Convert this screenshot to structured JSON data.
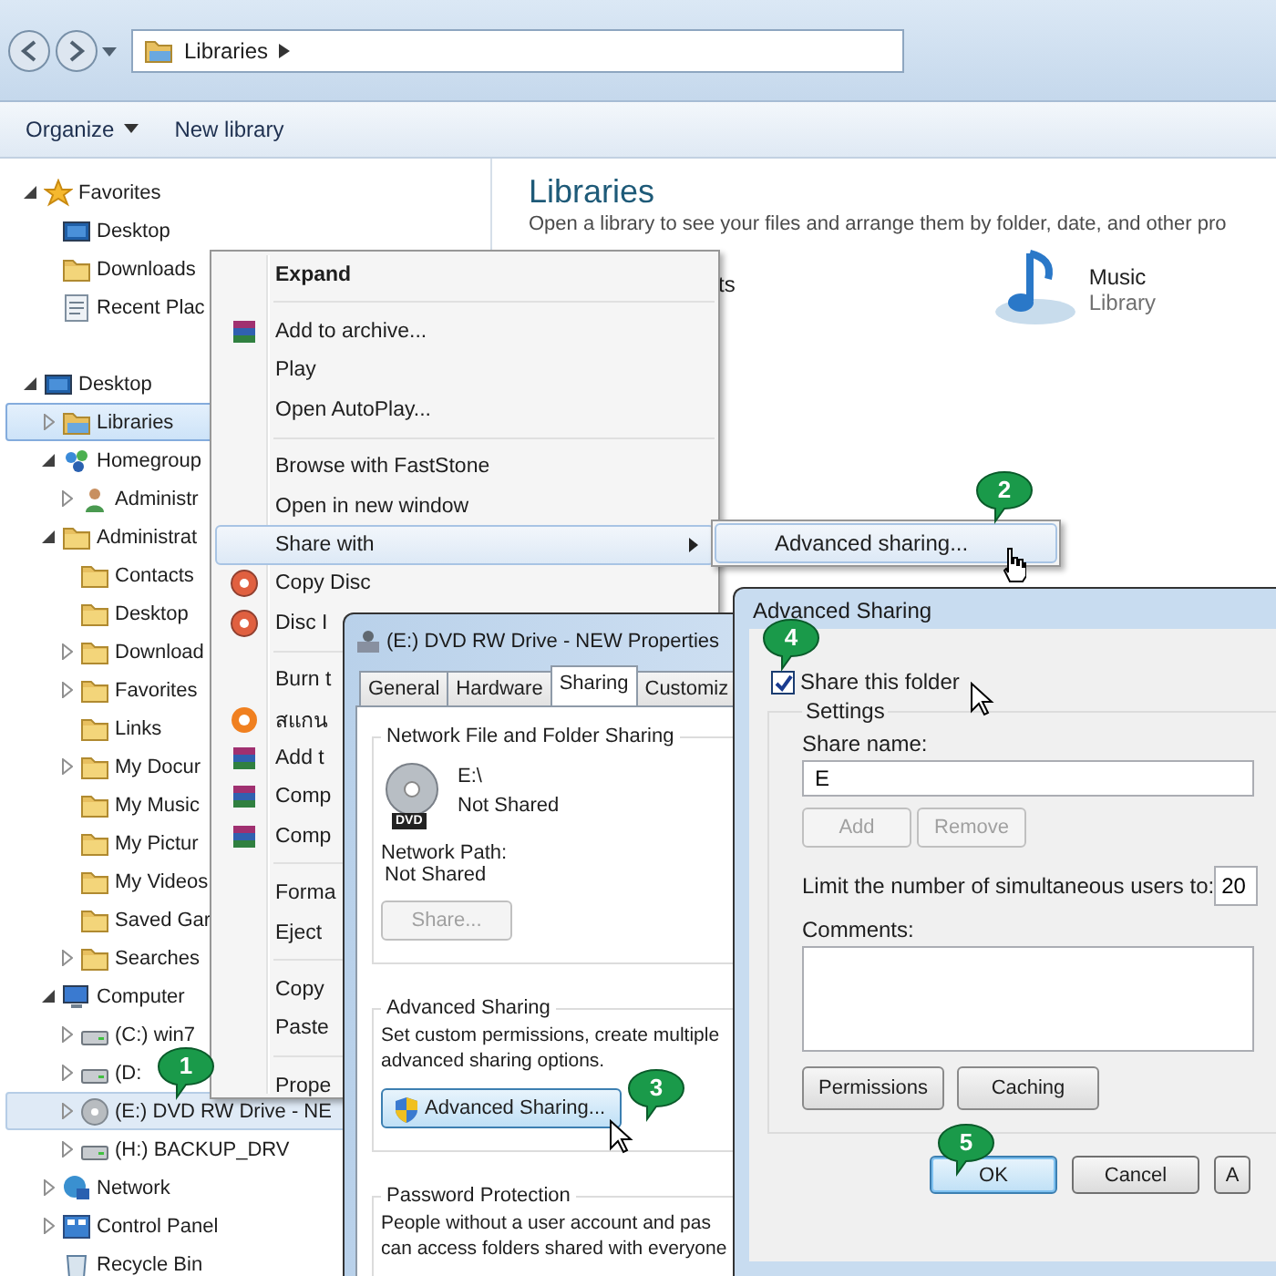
{
  "explorer": {
    "address_bar": {
      "crumbs": [
        "Libraries"
      ]
    },
    "toolbar": [
      {
        "label": "Organize",
        "dropdown": true
      },
      {
        "label": "New library",
        "dropdown": false
      }
    ],
    "nav_tree": [
      {
        "label": "Favorites",
        "kind": "star",
        "expanded": true,
        "selected": false,
        "children": [
          {
            "label": "Desktop",
            "kind": "monitor",
            "selected": false
          },
          {
            "label": "Downloads",
            "kind": "folder",
            "selected": false
          },
          {
            "label": "Recent Plac",
            "kind": "recent",
            "selected": false
          }
        ]
      },
      {
        "label": "Desktop",
        "kind": "monitor",
        "expanded": true,
        "selected": false,
        "children": [
          {
            "label": "Libraries",
            "kind": "library",
            "expanded": false,
            "selected": true
          },
          {
            "label": "Homegroup",
            "kind": "homegroup",
            "expanded": true,
            "selected": false,
            "children": [
              {
                "label": "Administr",
                "kind": "user",
                "expanded": false,
                "selected": false
              }
            ]
          },
          {
            "label": "Administrat",
            "kind": "folder",
            "expanded": true,
            "selected": false,
            "children": [
              {
                "label": "Contacts",
                "kind": "folder",
                "selected": false
              },
              {
                "label": "Desktop",
                "kind": "folder",
                "selected": false
              },
              {
                "label": "Download",
                "kind": "folder",
                "expanded": false,
                "selected": false
              },
              {
                "label": "Favorites",
                "kind": "folder",
                "expanded": false,
                "selected": false
              },
              {
                "label": "Links",
                "kind": "folder",
                "selected": false
              },
              {
                "label": "My Docur",
                "kind": "folder",
                "expanded": false,
                "selected": false
              },
              {
                "label": "My Music",
                "kind": "folder",
                "selected": false
              },
              {
                "label": "My Pictur",
                "kind": "folder",
                "selected": false
              },
              {
                "label": "My Videos",
                "kind": "folder",
                "selected": false
              },
              {
                "label": "Saved Gar",
                "kind": "folder",
                "selected": false
              },
              {
                "label": "Searches",
                "kind": "folder",
                "expanded": false,
                "selected": false
              }
            ]
          },
          {
            "label": "Computer",
            "kind": "computer",
            "expanded": true,
            "selected": false,
            "children": [
              {
                "label": "(C:) win7",
                "kind": "drive",
                "expanded": false,
                "selected": false
              },
              {
                "label": "(D:",
                "kind": "drive",
                "expanded": false,
                "selected": false
              },
              {
                "label": "(E:) DVD RW Drive - NE",
                "kind": "disc",
                "expanded": false,
                "selected": true
              },
              {
                "label": "(H:) BACKUP_DRV",
                "kind": "drive",
                "expanded": false,
                "selected": false
              }
            ]
          },
          {
            "label": "Network",
            "kind": "network",
            "expanded": false,
            "selected": false
          },
          {
            "label": "Control Panel",
            "kind": "panel",
            "expanded": false,
            "selected": false
          },
          {
            "label": "Recycle Bin",
            "kind": "bin",
            "selected": false
          }
        ]
      }
    ],
    "content": {
      "title": "Libraries",
      "subtitle": "Open a library to see your files and arrange them by folder, date, and other pro",
      "libraries": [
        {
          "kind": "partial",
          "name": "ts"
        },
        {
          "kind": "library",
          "name": "Music",
          "caption": "Library"
        }
      ]
    }
  },
  "context_menu": {
    "items": [
      {
        "kind": "default",
        "label": "Expand",
        "selected": false
      },
      {
        "kind": "separator"
      },
      {
        "kind": "archive",
        "label": "Add to archive...",
        "selected": false
      },
      {
        "kind": "item",
        "label": "Play",
        "selected": false
      },
      {
        "kind": "item",
        "label": "Open AutoPlay...",
        "selected": false
      },
      {
        "kind": "separator"
      },
      {
        "kind": "item",
        "label": "Browse with FastStone",
        "selected": false
      },
      {
        "kind": "item",
        "label": "Open in new window",
        "selected": false
      },
      {
        "kind": "submenu",
        "label": "Share with",
        "selected": true
      },
      {
        "kind": "disc",
        "label": "Copy Disc",
        "selected": false
      },
      {
        "kind": "disc",
        "label": "Disc I",
        "selected": false
      },
      {
        "kind": "separator"
      },
      {
        "kind": "item",
        "label": "Burn t",
        "selected": false
      },
      {
        "kind": "scan",
        "label": "สแกน",
        "selected": false
      },
      {
        "kind": "archive",
        "label": "Add t",
        "selected": false
      },
      {
        "kind": "archive",
        "label": "Comp",
        "selected": false
      },
      {
        "kind": "archive",
        "label": "Comp",
        "selected": false
      },
      {
        "kind": "separator"
      },
      {
        "kind": "item",
        "label": "Forma",
        "selected": false
      },
      {
        "kind": "item",
        "label": "Eject",
        "selected": false
      },
      {
        "kind": "separator"
      },
      {
        "kind": "item",
        "label": "Copy",
        "selected": false
      },
      {
        "kind": "item",
        "label": "Paste",
        "selected": false
      },
      {
        "kind": "separator"
      },
      {
        "kind": "item",
        "label": "Prope",
        "selected": false
      }
    ]
  },
  "submenu": {
    "items": [
      {
        "label": "Advanced sharing...",
        "selected": true
      }
    ]
  },
  "properties_dialog": {
    "title": "(E:) DVD RW Drive - NEW Properties",
    "tabs": [
      {
        "label": "General",
        "selected": false
      },
      {
        "label": "Hardware",
        "selected": false
      },
      {
        "label": "Sharing",
        "selected": true
      },
      {
        "label": "Customiz",
        "selected": false
      }
    ],
    "network_sharing": {
      "heading": "Network File and Folder Sharing",
      "icon_label": "DVD",
      "path": "E:\\",
      "status": "Not Shared",
      "network_path_label": "Network Path:",
      "network_path": "Not Shared",
      "share_button": {
        "label": "Share...",
        "disabled": true
      }
    },
    "advanced_sharing": {
      "heading": "Advanced Sharing",
      "description": [
        "Set custom permissions, create multiple",
        "advanced sharing options."
      ],
      "button": "Advanced Sharing..."
    },
    "password_protection": {
      "heading": "Password Protection",
      "description": [
        "People without a user account and pas",
        "can access folders shared with everyone"
      ]
    }
  },
  "advanced_sharing_dialog": {
    "title": "Advanced Sharing",
    "share_checkbox": {
      "label": "Share this folder",
      "checked": true
    },
    "settings": {
      "heading": "Settings",
      "share_name_label": "Share name:",
      "share_name": "E",
      "name_buttons": [
        {
          "label": "Add",
          "disabled": true
        },
        {
          "label": "Remove",
          "disabled": true
        }
      ],
      "limit_label": "Limit the number of simultaneous users to:",
      "limit_value": "20",
      "comments_label": "Comments:",
      "buttons": [
        {
          "label": "Permissions",
          "disabled": false
        },
        {
          "label": "Caching",
          "disabled": false
        }
      ]
    },
    "buttons": [
      {
        "label": "OK",
        "default": true
      },
      {
        "label": "Cancel",
        "default": false
      },
      {
        "label": "A",
        "default": false
      }
    ]
  },
  "callouts": [
    {
      "number": "1"
    },
    {
      "number": "2"
    },
    {
      "number": "3"
    },
    {
      "number": "4"
    },
    {
      "number": "5"
    }
  ]
}
